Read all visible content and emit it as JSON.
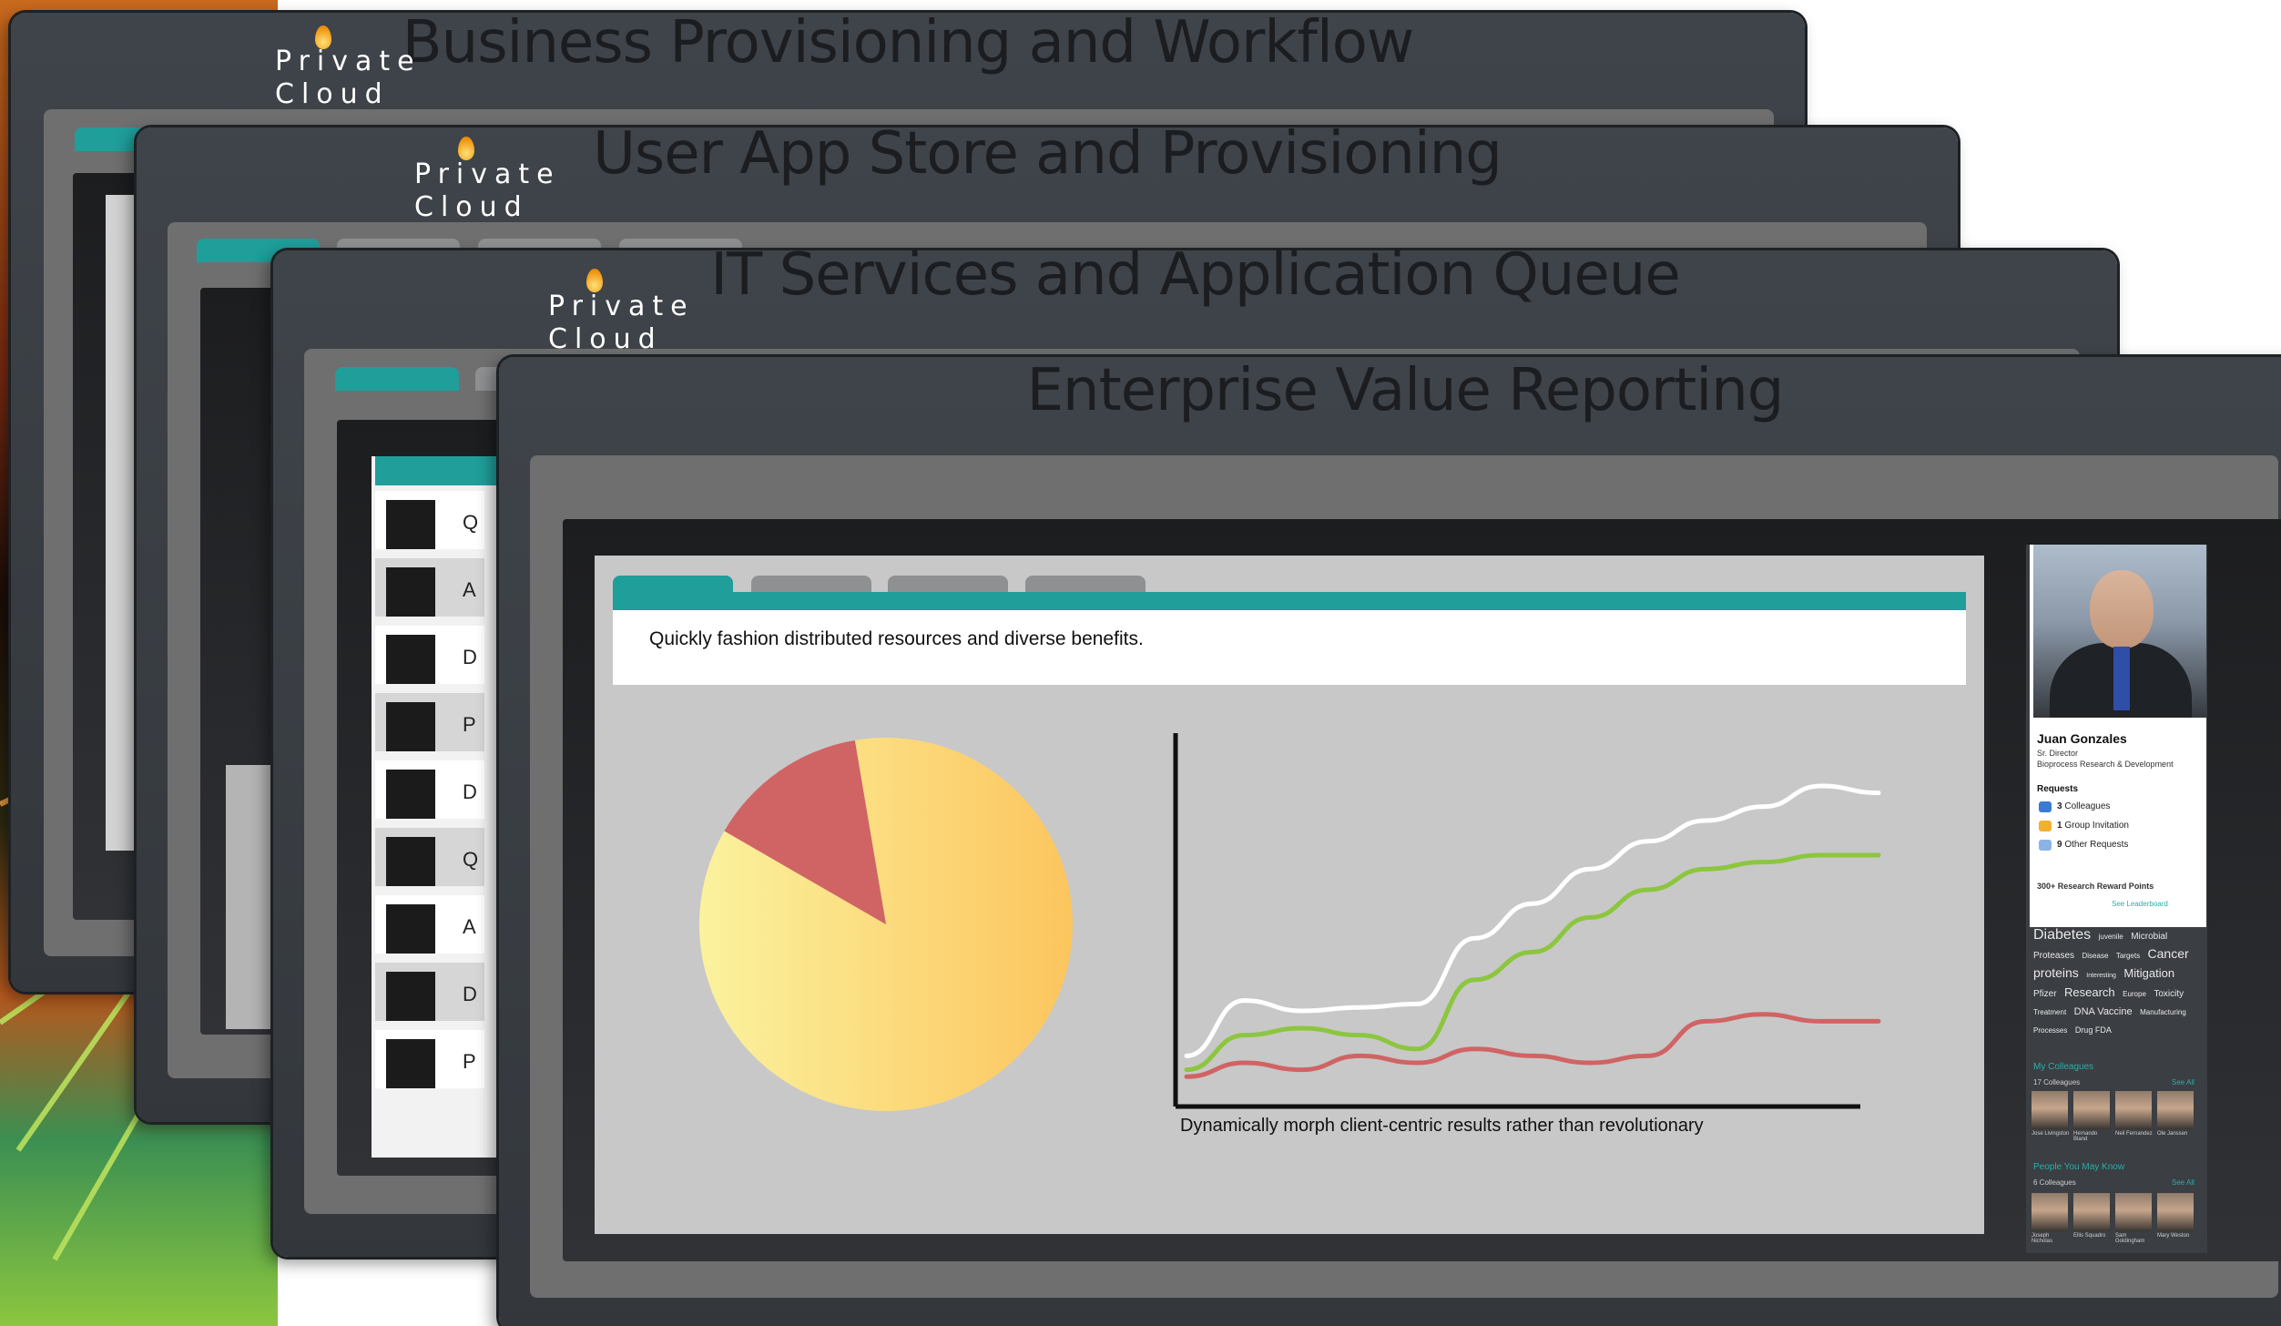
{
  "brand": {
    "line1": "Private",
    "line2": "Cloud"
  },
  "windows": {
    "w1": {
      "title": "Business Provisioning and Workflow"
    },
    "w2": {
      "title": "User App Store and Provisioning"
    },
    "w3": {
      "title": "IT Services and Application Queue",
      "rows": [
        "Q",
        "A",
        "D",
        "P",
        "D",
        "Q",
        "A",
        "D",
        "P"
      ]
    },
    "w4": {
      "title": "Enterprise Value Reporting",
      "tagline": "Quickly fashion distributed resources and diverse benefits.",
      "chart_caption": "Dynamically morph client-centric results rather than revolutionary"
    }
  },
  "chart_data": [
    {
      "type": "pie",
      "values": [
        86,
        14
      ],
      "colors": [
        "#fcd06a",
        "#d06464"
      ]
    },
    {
      "type": "line",
      "xlabel": "",
      "ylabel": "",
      "x": [
        0,
        1,
        2,
        3,
        4,
        5,
        6,
        7,
        8,
        9,
        10,
        11,
        12
      ],
      "series": [
        {
          "color": "#ffffff",
          "values": [
            12,
            28,
            25,
            26,
            27,
            46,
            56,
            66,
            74,
            80,
            84,
            90,
            88
          ]
        },
        {
          "color": "#8cc63f",
          "values": [
            8,
            18,
            20,
            18,
            14,
            34,
            42,
            52,
            60,
            66,
            68,
            70,
            70
          ]
        },
        {
          "color": "#d06464",
          "values": [
            6,
            10,
            8,
            12,
            10,
            14,
            12,
            10,
            12,
            22,
            24,
            22,
            22
          ]
        }
      ]
    }
  ],
  "profile": {
    "name": "Juan Gonzales",
    "title": "Sr. Director",
    "dept": "Bioprocess Research & Development",
    "requests_header": "Requests",
    "requests": [
      {
        "count": "3",
        "label": "Colleagues",
        "color": "#3a7bd5"
      },
      {
        "count": "1",
        "label": "Group Invitation",
        "color": "#f0b030"
      },
      {
        "count": "9",
        "label": "Other Requests",
        "color": "#8ab4e6"
      }
    ],
    "reward": "300+ Research Reward Points",
    "leaderboard": "See Leaderboard",
    "tags": [
      {
        "text": "Diabetes",
        "size": 16
      },
      {
        "text": "juvenile",
        "size": 8
      },
      {
        "text": "Microbial Proteases",
        "size": 10
      },
      {
        "text": "Disease",
        "size": 8
      },
      {
        "text": "Targets",
        "size": 8
      },
      {
        "text": "Cancer proteins",
        "size": 14
      },
      {
        "text": "Interesting",
        "size": 7
      },
      {
        "text": "Mitigation",
        "size": 13
      },
      {
        "text": "Pfizer",
        "size": 10
      },
      {
        "text": "Research",
        "size": 13
      },
      {
        "text": "Europe",
        "size": 8
      },
      {
        "text": "Toxicity",
        "size": 10
      },
      {
        "text": "Treatment",
        "size": 8
      },
      {
        "text": "DNA Vaccine",
        "size": 11
      },
      {
        "text": "Manufacturing Processes",
        "size": 8
      },
      {
        "text": "Drug FDA",
        "size": 9
      }
    ],
    "my_colleagues": "My Colleagues",
    "colleagues_count": "17 Colleagues",
    "see_all": "See All",
    "colleagues": [
      "Jose Livingston",
      "Hernando Bland",
      "Neil Fernandez",
      "Ole Janssen"
    ],
    "people_header": "People You May Know",
    "people_count": "6 Colleagues",
    "people": [
      "Joseph Nicholas",
      "Ellis Squadro",
      "Sam Goldingham",
      "Mary Weston"
    ]
  }
}
